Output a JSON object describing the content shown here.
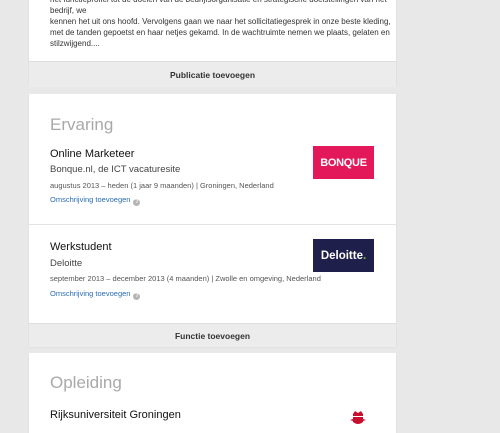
{
  "summary": {
    "text": "het functieprofiel tot de doelen van de bedrijfsorganisatie en strategische doelstellingen van het bedrijf, we\nkennen het uit ons hoofd. Vervolgens gaan we naar het sollicitatiegesprek in onze beste kleding,\nmet de tanden gepoetst en haar netjes gekamd. In de wachtruimte nemen we plaats, gelaten en\nstilzwijgend...."
  },
  "publication": {
    "add_label": "Publicatie toevoegen"
  },
  "experience": {
    "title": "Ervaring",
    "add_label": "Functie toevoegen",
    "items": [
      {
        "title": "Online Marketeer",
        "company": "Bonque.nl, de ICT vacaturesite",
        "meta": "augustus 2013 – heden (1 jaar 9 maanden)  |  Groningen, Nederland",
        "desc_link": "Omschrijving toevoegen",
        "logo_text": "BONQUE",
        "logo_color": "#e3185b"
      },
      {
        "title": "Werkstudent",
        "company": "Deloitte",
        "meta": "september 2013 – december 2013 (4 maanden)  |  Zwolle en omgeving, Nederland",
        "desc_link": "Omschrijving toevoegen",
        "logo_text": "Deloitte",
        "logo_dot": ".",
        "logo_color": "#1e1f4b"
      }
    ]
  },
  "education": {
    "title": "Opleiding",
    "items": [
      {
        "school": "Rijksuniversiteit Groningen"
      }
    ]
  },
  "icons": {
    "help": "help-icon",
    "crest": "university-crest-icon"
  },
  "colors": {
    "link": "#2a6db2",
    "section_title": "#a9a9a9",
    "background": "#e8e8e8"
  }
}
